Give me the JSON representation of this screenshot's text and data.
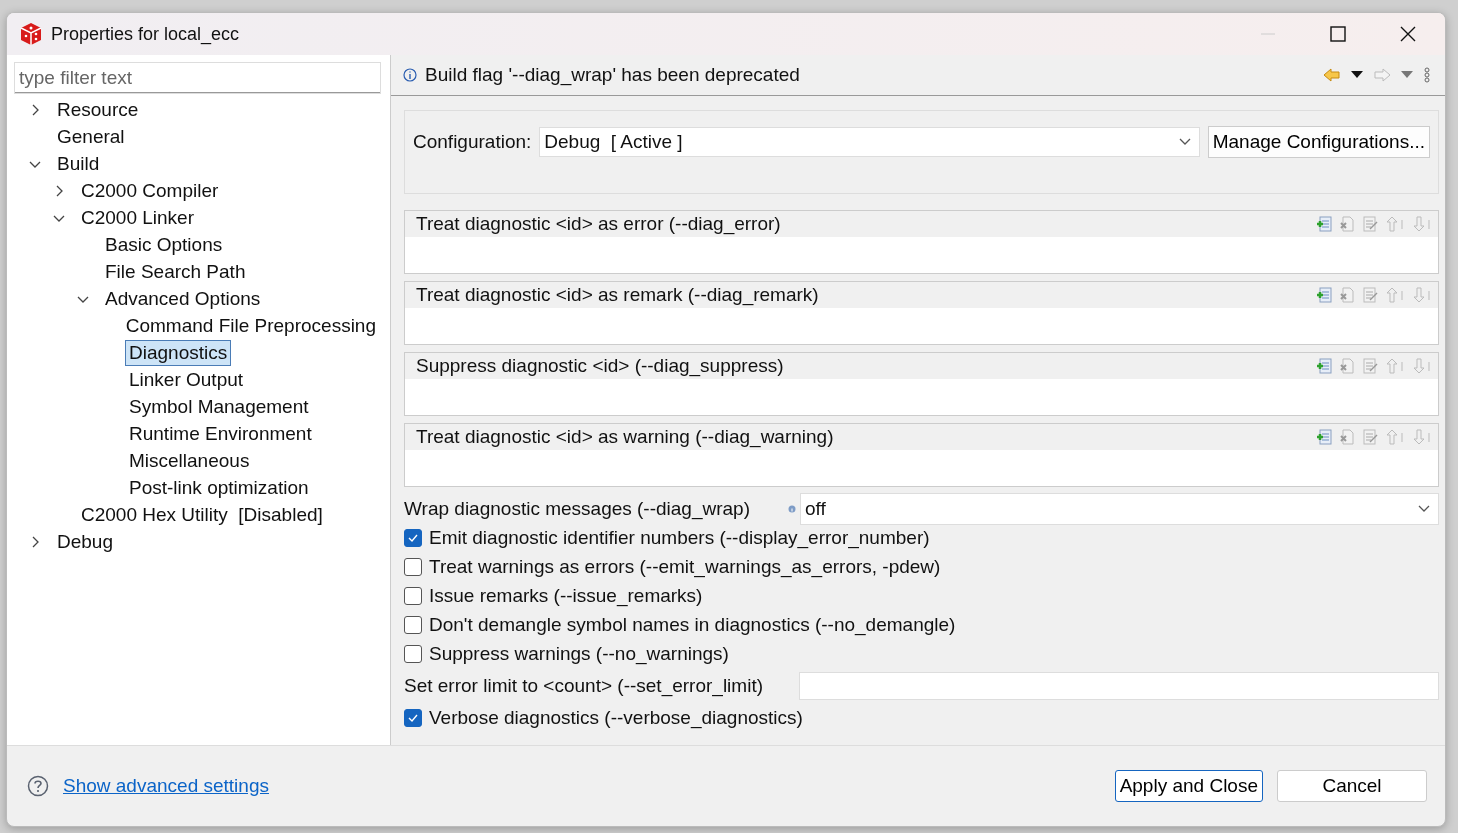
{
  "window": {
    "title": "Properties for local_ecc"
  },
  "filter": {
    "placeholder": "type filter text"
  },
  "tree": [
    {
      "label": "Resource",
      "expanded": false,
      "selected": false
    },
    {
      "label": "General",
      "selected": false
    },
    {
      "label": "Build",
      "expanded": true,
      "selected": false,
      "children": [
        {
          "label": "C2000 Compiler",
          "expanded": false,
          "selected": false
        },
        {
          "label": "C2000 Linker",
          "expanded": true,
          "selected": false,
          "children": [
            {
              "label": "Basic Options",
              "selected": false
            },
            {
              "label": "File Search Path",
              "selected": false
            },
            {
              "label": "Advanced Options",
              "expanded": true,
              "selected": false,
              "children": [
                {
                  "label": "Command File Preprocessing",
                  "selected": false
                },
                {
                  "label": "Diagnostics",
                  "selected": true
                },
                {
                  "label": "Linker Output",
                  "selected": false
                },
                {
                  "label": "Symbol Management",
                  "selected": false
                },
                {
                  "label": "Runtime Environment",
                  "selected": false
                },
                {
                  "label": "Miscellaneous",
                  "selected": false
                },
                {
                  "label": "Post-link optimization",
                  "selected": false
                }
              ]
            }
          ]
        },
        {
          "label": "C2000 Hex Utility  [Disabled]",
          "selected": false
        }
      ]
    },
    {
      "label": "Debug",
      "expanded": false,
      "selected": false
    }
  ],
  "message": "Build flag '--diag_wrap' has been deprecated",
  "configuration": {
    "label": "Configuration:",
    "value": "Debug  [ Active ]",
    "button": "Manage Configurations..."
  },
  "list_sections": [
    {
      "title": "Treat diagnostic <id> as error (--diag_error)"
    },
    {
      "title": "Treat diagnostic <id> as remark (--diag_remark)"
    },
    {
      "title": "Suppress diagnostic <id> (--diag_suppress)"
    },
    {
      "title": "Treat diagnostic <id> as warning (--diag_warning)"
    }
  ],
  "options": [
    {
      "kind": "select",
      "label": "Wrap diagnostic messages (--diag_wrap)",
      "value": "off"
    },
    {
      "kind": "checkbox",
      "label": "Emit diagnostic identifier numbers (--display_error_number)",
      "checked": true
    },
    {
      "kind": "checkbox",
      "label": "Treat warnings as errors (--emit_warnings_as_errors, -pdew)",
      "checked": false
    },
    {
      "kind": "checkbox",
      "label": "Issue remarks (--issue_remarks)",
      "checked": false
    },
    {
      "kind": "checkbox",
      "label": "Don't demangle symbol names in diagnostics (--no_demangle)",
      "checked": false
    },
    {
      "kind": "checkbox",
      "label": "Suppress warnings (--no_warnings)",
      "checked": false
    },
    {
      "kind": "text",
      "label": "Set error limit to <count> (--set_error_limit)"
    },
    {
      "kind": "checkbox",
      "label": "Verbose diagnostics (--verbose_diagnostics)",
      "checked": true
    }
  ],
  "footer": {
    "link": "Show advanced settings",
    "buttons": [
      {
        "label": "Apply and Close",
        "selected": true
      },
      {
        "label": "Cancel",
        "selected": false
      }
    ]
  }
}
